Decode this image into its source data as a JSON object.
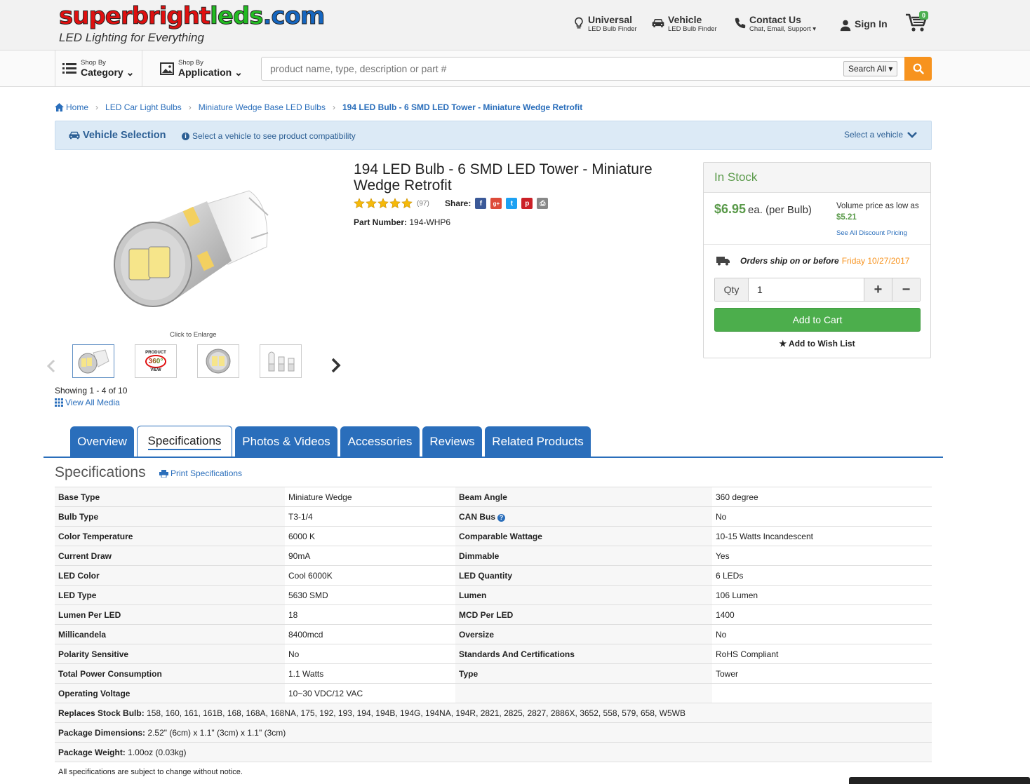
{
  "brand": {
    "logo_text_1": "superbright",
    "logo_text_2": "leds",
    "logo_text_3": ".com",
    "tagline": "LED Lighting for Everything",
    "color_red": "#e01010",
    "color_green": "#22bb22",
    "color_blue": "#1566c0"
  },
  "header_nav": [
    {
      "title": "Universal",
      "sub": "LED Bulb Finder",
      "icon": "bulb-icon"
    },
    {
      "title": "Vehicle",
      "sub": "LED Bulb Finder",
      "icon": "car-icon"
    },
    {
      "title": "Contact Us",
      "sub": "Chat, Email, Support",
      "icon": "phone-icon"
    },
    {
      "title": "Sign In",
      "sub": "",
      "icon": "user-icon"
    }
  ],
  "cart": {
    "count": "0"
  },
  "subbar": {
    "shop_category_small": "Shop By",
    "shop_category_big": "Category",
    "shop_app_small": "Shop By",
    "shop_app_big": "Application",
    "search_placeholder": "product name, type, description or part #",
    "search_scope": "Search All"
  },
  "breadcrumb": [
    "Home",
    "LED Car Light Bulbs",
    "Miniature Wedge Base LED Bulbs",
    "194 LED Bulb - 6 SMD LED Tower - Miniature Wedge Retrofit"
  ],
  "vehicle_bar": {
    "title": "Vehicle Selection",
    "hint": "Select a vehicle to see product compatibility",
    "select": "Select a vehicle"
  },
  "gallery": {
    "enlarge": "Click to Enlarge",
    "showing": "Showing 1 - 4 of 10",
    "view_all": "View All Media",
    "thumb_360_top": "PRODUCT",
    "thumb_360_mid": "360°",
    "thumb_360_bot": "VIEW"
  },
  "product": {
    "title": "194 LED Bulb - 6 SMD LED Tower - Miniature Wedge Retrofit",
    "rating": 5,
    "review_count": "(97)",
    "share_label": "Share:",
    "part_label": "Part Number:",
    "part_number": "194-WHP6"
  },
  "buybox": {
    "stock": "In Stock",
    "price": "$6.95",
    "price_unit": "ea. (per Bulb)",
    "volume_text": "Volume price as low as",
    "volume_price": "$5.21",
    "discount_link": "See All Discount Pricing",
    "ship_text": "Orders ship on or before",
    "ship_date": "Friday 10/27/2017",
    "qty_label": "Qty",
    "qty_value": "1",
    "add_to_cart": "Add to Cart",
    "wishlist": "★ Add to Wish List"
  },
  "tabs": [
    "Overview",
    "Specifications",
    "Photos & Videos",
    "Accessories",
    "Reviews",
    "Related Products"
  ],
  "specs": {
    "heading": "Specifications",
    "print": "Print Specifications",
    "rows": [
      [
        "Base Type",
        "Miniature Wedge",
        "Beam Angle",
        "360 degree"
      ],
      [
        "Bulb Type",
        "T3-1/4",
        "CAN Bus",
        "No"
      ],
      [
        "Color Temperature",
        "6000 K",
        "Comparable Wattage",
        "10-15 Watts Incandescent"
      ],
      [
        "Current Draw",
        "90mA",
        "Dimmable",
        "Yes"
      ],
      [
        "LED Color",
        "Cool 6000K",
        "LED Quantity",
        "6 LEDs"
      ],
      [
        "LED Type",
        "5630 SMD",
        "Lumen",
        "106 Lumen"
      ],
      [
        "Lumen Per LED",
        "18",
        "MCD Per LED",
        "1400"
      ],
      [
        "Millicandela",
        "8400mcd",
        "Oversize",
        "No"
      ],
      [
        "Polarity Sensitive",
        "No",
        "Standards And Certifications",
        "RoHS Compliant"
      ],
      [
        "Total Power Consumption",
        "1.1 Watts",
        "Type",
        "Tower"
      ],
      [
        "Operating Voltage",
        "10~30 VDC/12 VAC",
        "",
        ""
      ]
    ],
    "full_rows": [
      [
        "Replaces Stock Bulb:",
        "158, 160, 161, 161B, 168, 168A, 168NA, 175, 192, 193, 194, 194B, 194G, 194NA, 194R, 2821, 2825, 2827, 2886X, 3652, 558, 579, 658, W5WB"
      ],
      [
        "Package Dimensions:",
        "2.52\" (6cm) x 1.1\" (3cm) x 1.1\" (3cm)"
      ],
      [
        "Package Weight:",
        "1.00oz (0.03kg)"
      ]
    ],
    "note": "All specifications are subject to change without notice."
  }
}
